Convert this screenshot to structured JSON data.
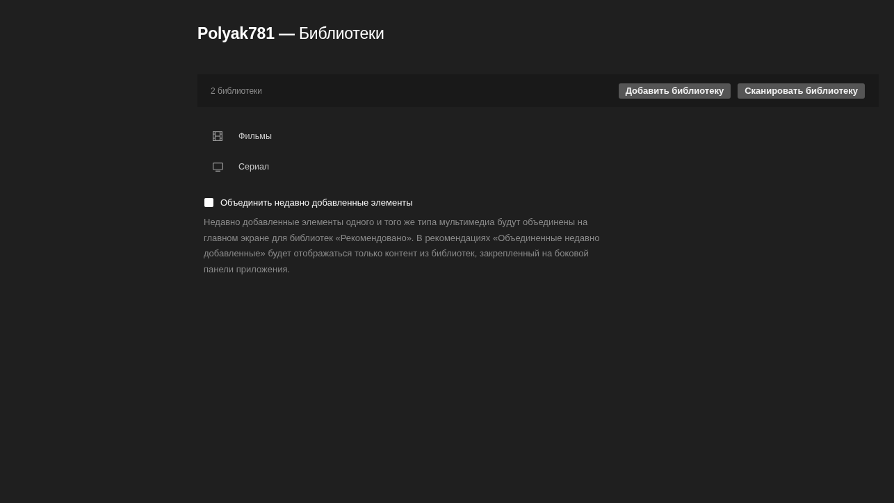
{
  "page": {
    "title": "**Polyak781 —** Библиотеки"
  },
  "header_bar": {
    "count": "2 библиотеки",
    "buttons": [
      "Добавить библиотеку",
      "Сканировать библиотеку"
    ]
  },
  "libraries": [
    {
      "kind": "movie",
      "name": "Фильмы"
    },
    {
      "kind": "tv",
      "name": "Сериал"
    }
  ],
  "option": {
    "label": "Объединить недавно добавленные элементы",
    "checked": false,
    "description": "Недавно добавленные элементы одного и того же типа мультимедиа будут объединены на главном экране для библиотек «Рекомендовано». В рекомендациях «Объединенные недавно добавленные» будет отображаться только контент из библиотек, закрепленный на боковой панели приложения."
  }
}
